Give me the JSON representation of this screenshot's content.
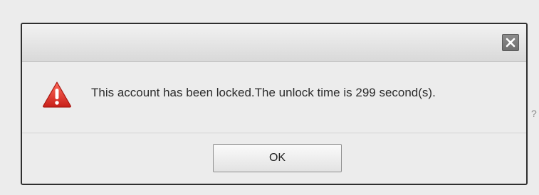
{
  "dialog": {
    "message": "This account has been locked.The unlock time is 299 second(s).",
    "ok_label": "OK",
    "close_icon": "close-icon",
    "warning_icon": "warning-triangle-icon"
  },
  "background": {
    "partial_text": "?"
  },
  "colors": {
    "warning_red": "#e0302a",
    "close_button": "#7c7c7c",
    "border": "#2f2f2f"
  }
}
